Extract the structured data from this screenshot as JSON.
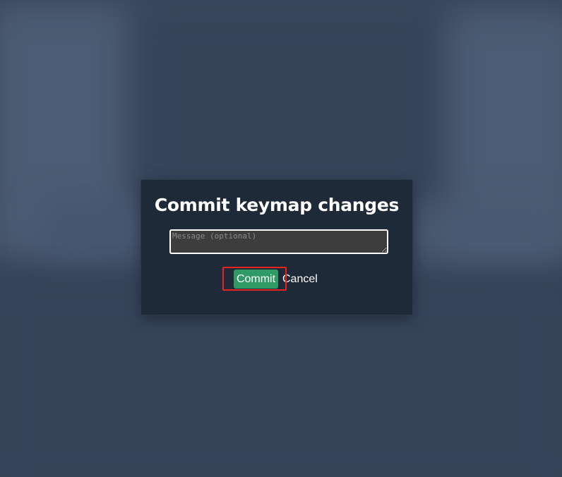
{
  "dialog": {
    "title": "Commit keymap changes",
    "message_input": {
      "value": "",
      "placeholder": "Message (optional)"
    },
    "commit_label": "Commit",
    "cancel_label": "Cancel"
  },
  "colors": {
    "background": "#36445a",
    "dialog_background": "#1f2a38",
    "commit_button": "#2f9a66",
    "highlight": "#e8231f"
  }
}
